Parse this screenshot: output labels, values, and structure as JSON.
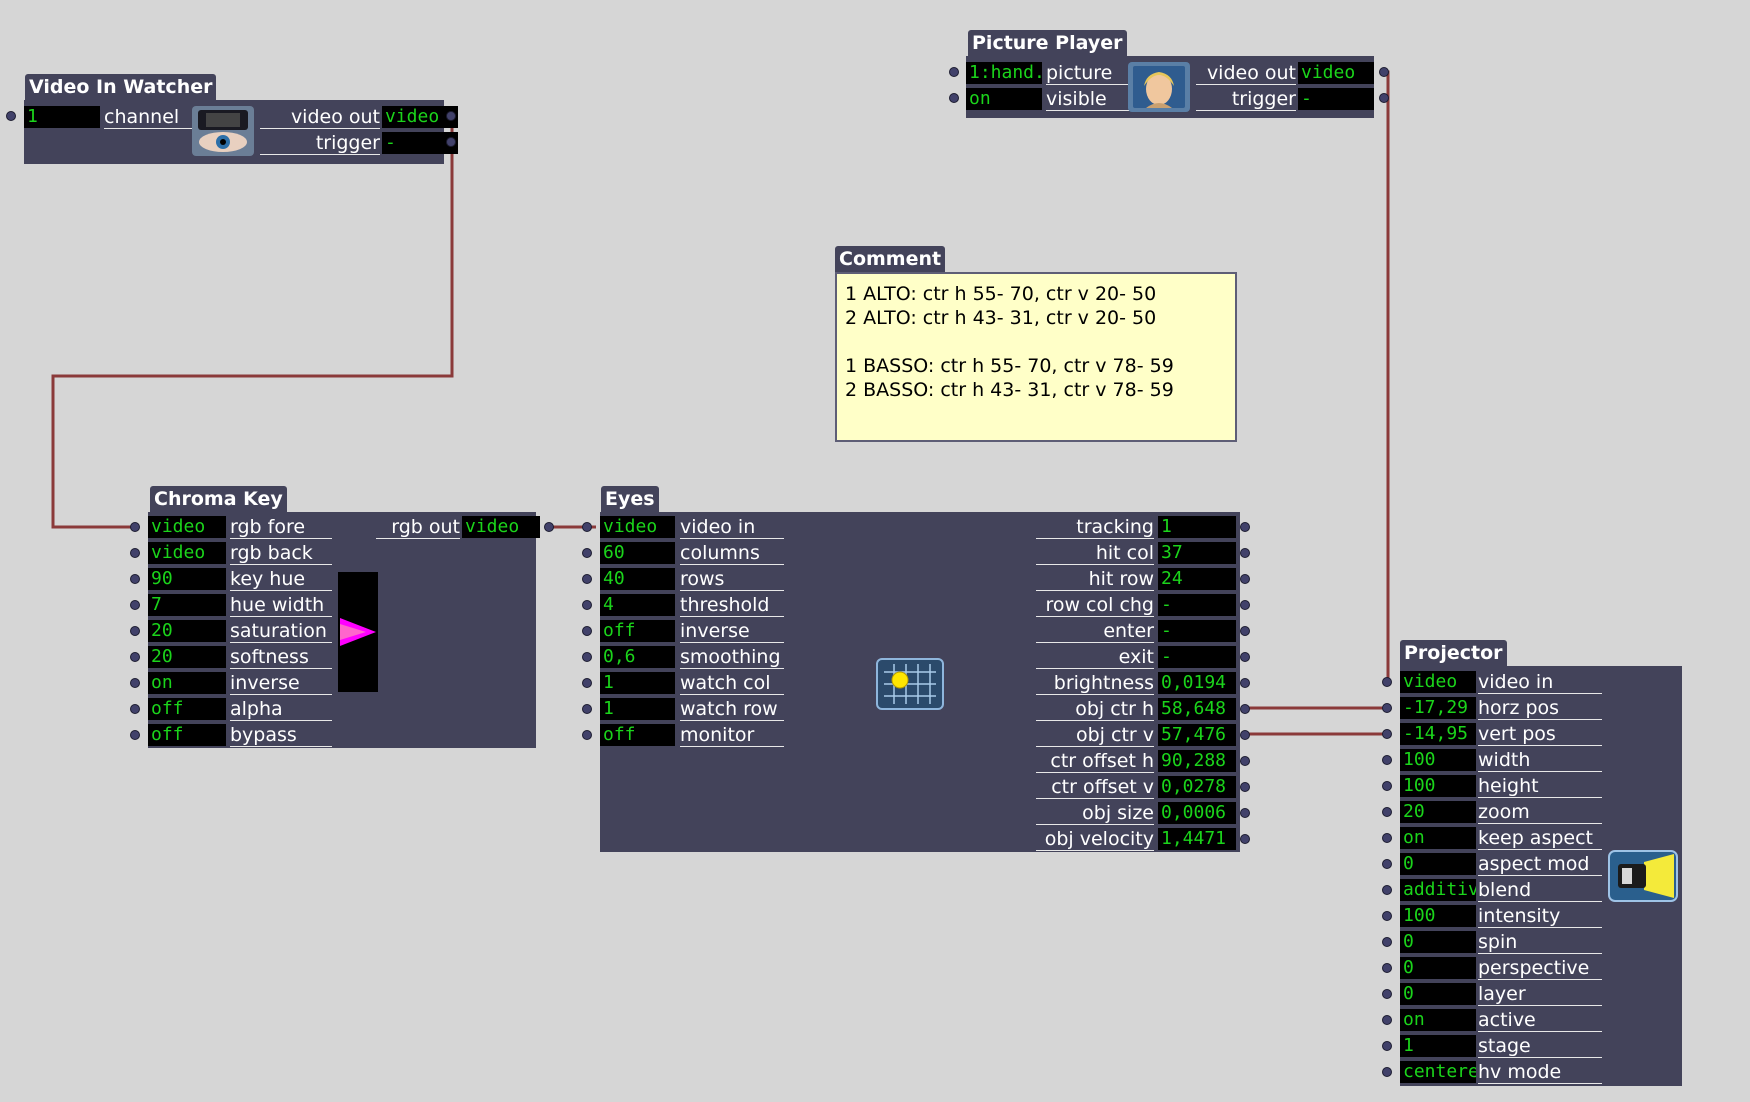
{
  "video_in_watcher": {
    "title": "Video In Watcher",
    "inputs": [
      {
        "value": "1",
        "label": "channel"
      }
    ],
    "outputs": [
      {
        "label": "video out",
        "value": "video"
      },
      {
        "label": "trigger",
        "value": "-"
      }
    ],
    "icon": "eye-camera-icon"
  },
  "picture_player": {
    "title": "Picture Player",
    "inputs": [
      {
        "value": "1:hand.",
        "label": "picture"
      },
      {
        "value": "on",
        "label": "visible"
      }
    ],
    "outputs": [
      {
        "label": "video out",
        "value": "video"
      },
      {
        "label": "trigger",
        "value": "-"
      }
    ],
    "icon": "portrait-thumbnail-icon"
  },
  "comment": {
    "title": "Comment",
    "text": "1 ALTO: ctr h 55- 70, ctr v 20- 50\n2 ALTO: ctr h 43- 31, ctr v 20- 50\n\n1 BASSO: ctr h 55- 70, ctr v 78- 59\n2 BASSO: ctr h 43- 31, ctr v 78- 59"
  },
  "chroma_key": {
    "title": "Chroma Key",
    "inputs": [
      {
        "value": "video",
        "label": "rgb fore"
      },
      {
        "value": "video",
        "label": "rgb back"
      },
      {
        "value": "90",
        "label": "key hue"
      },
      {
        "value": "7",
        "label": "hue width"
      },
      {
        "value": "20",
        "label": "saturation"
      },
      {
        "value": "20",
        "label": "softness"
      },
      {
        "value": "on",
        "label": "inverse"
      },
      {
        "value": "off",
        "label": "alpha"
      },
      {
        "value": "off",
        "label": "bypass"
      }
    ],
    "outputs": [
      {
        "label": "rgb out",
        "value": "video"
      }
    ],
    "icon": "hue-triangle-icon",
    "colors": {
      "hue_swatch": "#ff00ff"
    }
  },
  "eyes": {
    "title": "Eyes",
    "inputs": [
      {
        "value": "video",
        "label": "video in"
      },
      {
        "value": "60",
        "label": "columns"
      },
      {
        "value": "40",
        "label": "rows"
      },
      {
        "value": "4",
        "label": "threshold"
      },
      {
        "value": "off",
        "label": "inverse"
      },
      {
        "value": "0,6",
        "label": "smoothing"
      },
      {
        "value": "1",
        "label": "watch col"
      },
      {
        "value": "1",
        "label": "watch row"
      },
      {
        "value": "off",
        "label": "monitor"
      }
    ],
    "outputs": [
      {
        "label": "tracking",
        "value": "1"
      },
      {
        "label": "hit col",
        "value": "37"
      },
      {
        "label": "hit row",
        "value": "24"
      },
      {
        "label": "row col chg",
        "value": "-"
      },
      {
        "label": "enter",
        "value": "-"
      },
      {
        "label": "exit",
        "value": "-"
      },
      {
        "label": "brightness",
        "value": "0,0194"
      },
      {
        "label": "obj ctr h",
        "value": "58,648"
      },
      {
        "label": "obj ctr v",
        "value": "57,476"
      },
      {
        "label": "ctr offset h",
        "value": "90,288"
      },
      {
        "label": "ctr offset v",
        "value": "0,0278"
      },
      {
        "label": "obj size",
        "value": "0,0006"
      },
      {
        "label": "obj velocity",
        "value": "1,4471"
      }
    ],
    "icon": "tracking-grid-icon"
  },
  "projector": {
    "title": "Projector",
    "inputs": [
      {
        "value": "video",
        "label": "video in"
      },
      {
        "value": "-17,29",
        "label": "horz pos"
      },
      {
        "value": "-14,95",
        "label": "vert pos"
      },
      {
        "value": "100",
        "label": "width"
      },
      {
        "value": "100",
        "label": "height"
      },
      {
        "value": "20",
        "label": "zoom"
      },
      {
        "value": "on",
        "label": "keep aspect"
      },
      {
        "value": "0",
        "label": "aspect mod"
      },
      {
        "value": "additive",
        "label": "blend"
      },
      {
        "value": "100",
        "label": "intensity"
      },
      {
        "value": "0",
        "label": "spin"
      },
      {
        "value": "0",
        "label": "perspective"
      },
      {
        "value": "0",
        "label": "layer"
      },
      {
        "value": "on",
        "label": "active"
      },
      {
        "value": "1",
        "label": "stage"
      },
      {
        "value": "centere",
        "label": "hv mode"
      }
    ],
    "icon": "projector-lamp-icon"
  },
  "colors": {
    "canvas": "#d6d6d6",
    "actor_body": "#43435a",
    "value_bg": "#000000",
    "value_text": "#1bd41b",
    "wire": "#8b3a3a",
    "comment_bg": "#ffffc8"
  }
}
